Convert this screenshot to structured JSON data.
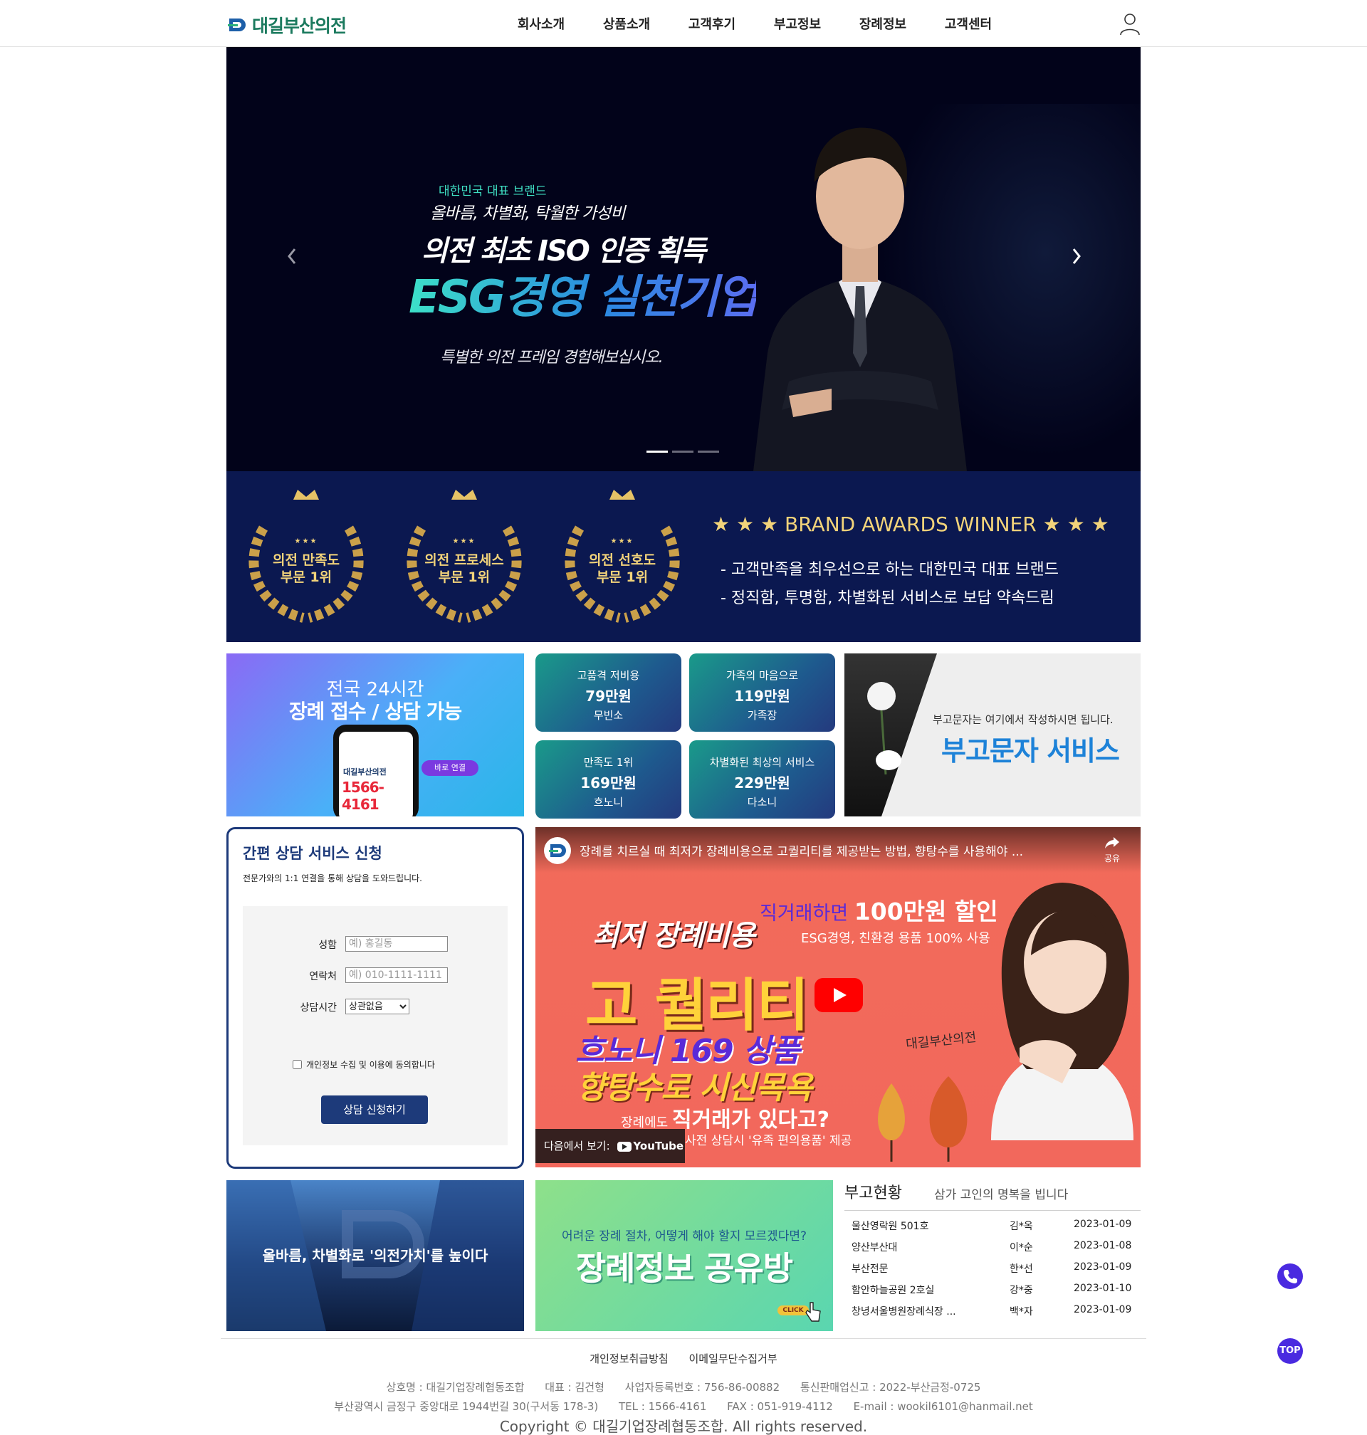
{
  "header": {
    "logo_text": "대길부산의전",
    "nav": [
      "회사소개",
      "상품소개",
      "고객후기",
      "부고정보",
      "장례정보",
      "고객센터"
    ]
  },
  "hero": {
    "sub1": "대한민국 대표 브랜드",
    "sub2": "올바름, 차별화, 탁월한 가성비",
    "headline1": "의전 최초 ISO 인증 획득",
    "headline2": "ESG경영 실천기업",
    "desc": "특별한 의전 프레임 경험해보십시오.",
    "active_slide": 1,
    "slide_count": 3
  },
  "awards": {
    "wreaths": [
      {
        "stars": "★★★",
        "line1": "의전 만족도",
        "line2": "부문 1위"
      },
      {
        "stars": "★★★",
        "line1": "의전 프로세스",
        "line2": "부문 1위"
      },
      {
        "stars": "★★★",
        "line1": "의전 선호도",
        "line2": "부문 1위"
      }
    ],
    "title": "★ ★ ★  BRAND AWARDS WINNER  ★ ★ ★",
    "lines": [
      "- 고객만족을 최우선으로 하는 대한민국 대표 브랜드",
      "- 정직함, 투명함, 차별화된 서비스로 보답 약속드림"
    ],
    "gold": "#f2d37a"
  },
  "banner24": {
    "line1": "전국 24시간",
    "line2": "장례 접수 / 상담 가능",
    "phone_brand": "대길부산의전",
    "phone_number": "1566-4161",
    "direct_label": "바로 연결"
  },
  "price_cards": [
    {
      "label": "고품격 저비용",
      "price": "79만원",
      "name": "무빈소"
    },
    {
      "label": "가족의 마음으로",
      "price": "119만원",
      "name": "가족장"
    },
    {
      "label": "만족도 1위",
      "price": "169만원",
      "name": "흐노니"
    },
    {
      "label": "차별화된 최상의 서비스",
      "price": "229만원",
      "name": "다소니"
    }
  ],
  "obit_banner": {
    "small": "부고문자는 여기에서 작성하시면 됩니다.",
    "big": "부고문자 서비스"
  },
  "consult": {
    "title": "간편 상담 서비스 신청",
    "subtitle": "전문가와의 1:1 연결을 통해 상담을 도와드립니다.",
    "name_label": "성함",
    "name_placeholder": "예) 홍길동",
    "phone_label": "연락처",
    "phone_placeholder": "예) 010-1111-1111",
    "time_label": "상담시간",
    "time_selected": "상관없음",
    "agree_label": "개인정보 수집 및 이용에 동의합니다",
    "submit_label": "상담 신청하기"
  },
  "video": {
    "title": "장례를 치르실 때 최저가 장례비용으로 고퀄리티를 제공받는 방법, 향탕수를 사용해야 ...",
    "share_label": "공유",
    "discount_prefix": "직거래하면",
    "discount_value": "100만원 할인",
    "eco": "ESG경영, 친환경 용품 100% 사용",
    "low": "최저 장례비용",
    "quality": "고 퀄리티",
    "hon": "흐노니 169 상품",
    "hyang": "향탕수로 시신목욕",
    "direct_prefix": "장례에도",
    "direct_main": "직거래가 있다고?",
    "consult_note": "사전 상담시 '유족 편의용품' 제공",
    "brand": "대길부산의전",
    "watch_label": "다음에서 보기:",
    "youtube_label": "YouTube"
  },
  "banner_value": {
    "text": "올바름, 차별화로 '의전가치'를 높이다"
  },
  "banner_share": {
    "small": "어려운 장례 절차, 어떻게 해야 할지 모르겠다면?",
    "big": "장례정보 공유방",
    "click": "CLICK"
  },
  "obit_status": {
    "title": "부고현황",
    "subtitle": "삼가 고인의 명복을 빕니다",
    "rows": [
      {
        "place": "울산영락원 501호",
        "name": "김*옥",
        "date": "2023-01-09"
      },
      {
        "place": "양산부산대",
        "name": "이*순",
        "date": "2023-01-08"
      },
      {
        "place": "부산전문",
        "name": "한*선",
        "date": "2023-01-09"
      },
      {
        "place": "함안하늘공원 2호실",
        "name": "강*중",
        "date": "2023-01-10"
      },
      {
        "place": "창녕서울병원장례식장 ...",
        "name": "백*자",
        "date": "2023-01-09"
      }
    ]
  },
  "floating": {
    "top_label": "TOP"
  },
  "footer": {
    "links": [
      "개인정보취급방침",
      "이메일무단수집거부"
    ],
    "info1": [
      "상호명 : 대길기업장례협동조합",
      "대표 : 김건형",
      "사업자등록번호 : 756-86-00882",
      "통신판매업신고 : 2022-부산금정-0725"
    ],
    "info2": [
      "부산광역시 금정구 중앙대로 1944번길 30(구서동 178-3)",
      "TEL : 1566-4161",
      "FAX : 051-919-4112",
      "E-mail : wookil6101@hanmail.net"
    ],
    "copyright": "Copyright © 대길기업장례협동조합. All rights reserved."
  },
  "colors": {
    "navy": "#0b1850",
    "accent_purple": "#4a2ae0",
    "form_border": "#1d3a7a",
    "obit_blue": "#1d82d8"
  }
}
